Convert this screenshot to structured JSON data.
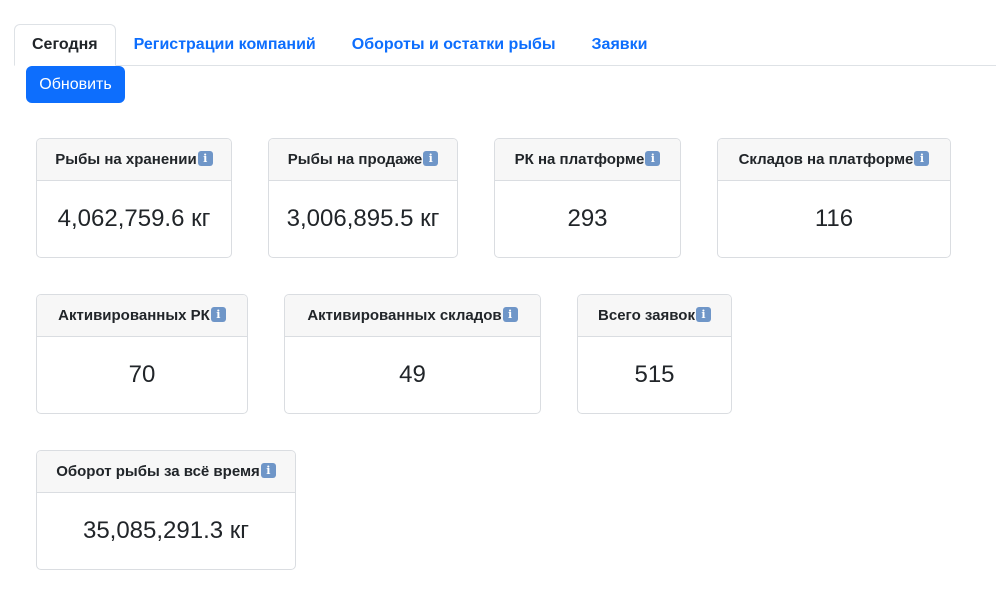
{
  "tabs": [
    {
      "label": "Сегодня",
      "active": true
    },
    {
      "label": "Регистрации компаний",
      "active": false
    },
    {
      "label": "Обороты и остатки рыбы",
      "active": false
    },
    {
      "label": "Заявки",
      "active": false
    }
  ],
  "refresh_button": "Обновить",
  "info_icon": "i",
  "cards": {
    "fish_storage": {
      "title": "Рыбы на хранении",
      "value": "4,062,759.6 кг"
    },
    "fish_sale": {
      "title": "Рыбы на продаже",
      "value": "3,006,895.5 кг"
    },
    "rk_platform": {
      "title": "РК на платформе",
      "value": "293"
    },
    "warehouses_platform": {
      "title": "Складов на платформе",
      "value": "116"
    },
    "active_rk": {
      "title": "Активированных РК",
      "value": "70"
    },
    "active_warehouses": {
      "title": "Активированных складов",
      "value": "49"
    },
    "total_requests": {
      "title": "Всего заявок",
      "value": "515"
    },
    "fish_turnover": {
      "title": "Оборот рыбы за всё время",
      "value": "35,085,291.3 кг"
    }
  },
  "colors": {
    "primary": "#0d6efd",
    "info_icon": "#6f96c8",
    "header_bg": "#f7f7f7"
  }
}
